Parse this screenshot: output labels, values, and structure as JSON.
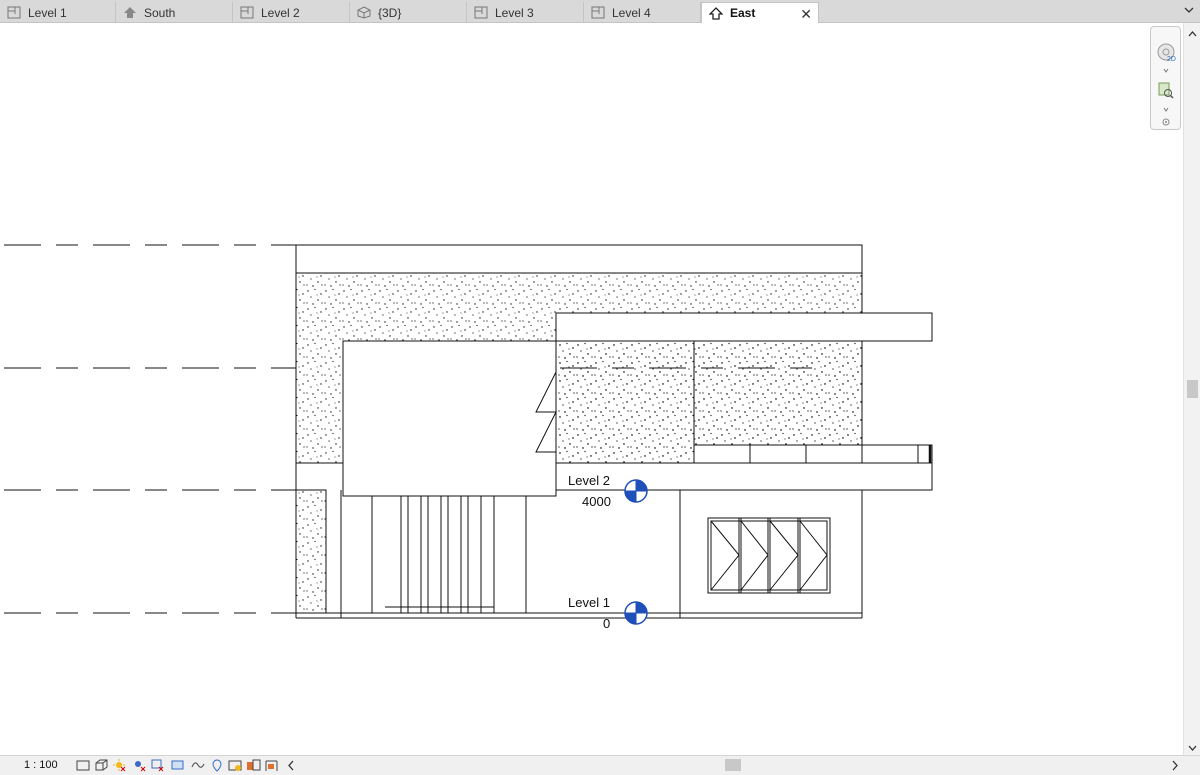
{
  "tabs": [
    {
      "label": "Level 1",
      "icon": "floor-plan-icon"
    },
    {
      "label": "South",
      "icon": "elevation-icon"
    },
    {
      "label": "Level 2",
      "icon": "floor-plan-icon"
    },
    {
      "label": "{3D}",
      "icon": "3d-view-icon"
    },
    {
      "label": "Level 3",
      "icon": "floor-plan-icon"
    },
    {
      "label": "Level 4",
      "icon": "floor-plan-icon"
    },
    {
      "label": "East",
      "icon": "elevation-icon",
      "active": true
    }
  ],
  "close_symbol": "✕",
  "levels": [
    {
      "name": "Level 2",
      "elevation": "4000"
    },
    {
      "name": "Level 1",
      "elevation": "0"
    }
  ],
  "status": {
    "scale": "1 : 100"
  },
  "colors": {
    "level_marker": "#1f4fb8",
    "canvas": "#ffffff",
    "tabbar": "#d9d9d9"
  }
}
